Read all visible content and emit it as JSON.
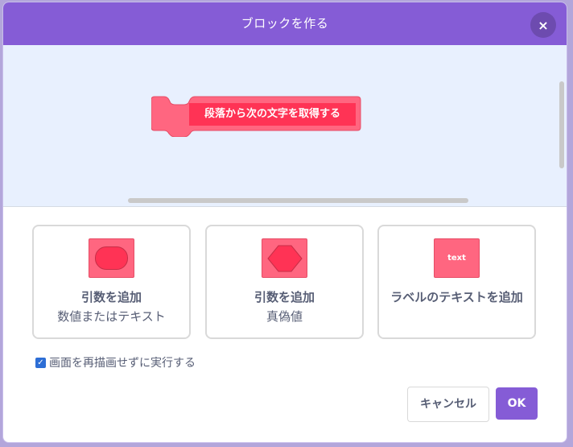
{
  "modal": {
    "title": "ブロックを作る",
    "close_icon": "close-icon",
    "close_glyph": "×"
  },
  "workspace": {
    "block_label": "段落から次の文字を取得する",
    "block_color": "#ff6680",
    "block_label_color": "#ff3355"
  },
  "options": [
    {
      "icon": "number-text-input-icon",
      "title": "引数を追加",
      "subtitle": "数値またはテキスト"
    },
    {
      "icon": "boolean-input-icon",
      "title": "引数を追加",
      "subtitle": "真偽値"
    },
    {
      "icon": "label-text-icon",
      "icon_text": "text",
      "title": "ラベルのテキストを追加",
      "subtitle": ""
    }
  ],
  "run_without_refresh": {
    "checked": true,
    "label": "画面を再描画せずに実行する"
  },
  "footer": {
    "cancel_label": "キャンセル",
    "ok_label": "OK"
  },
  "colors": {
    "accent": "#855cd6",
    "workspace_bg": "#e8f0fe",
    "text": "#575e75"
  }
}
